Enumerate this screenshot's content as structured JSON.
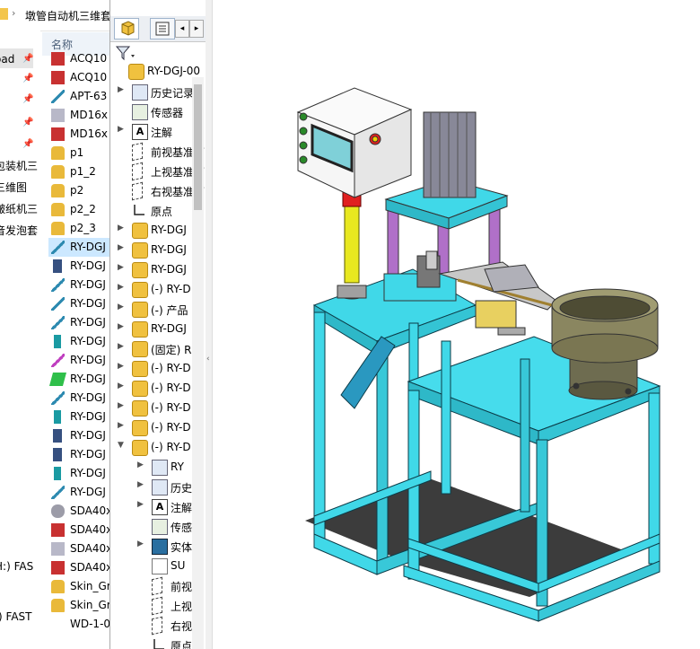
{
  "explorer": {
    "address_path": "墩管自动机三维套",
    "column_header": "名称",
    "nav_items": [
      {
        "label": "oad",
        "pinned": true
      },
      {
        "label": "",
        "pinned": true
      },
      {
        "label": "",
        "pinned": true
      },
      {
        "label": "",
        "pinned": true
      },
      {
        "label": "",
        "pinned": true
      },
      {
        "label": "包装机三",
        "pinned": false
      },
      {
        "label": "三维图",
        "pinned": false
      },
      {
        "label": "皱纸机三",
        "pinned": false
      },
      {
        "label": "音发泡套",
        "pinned": false
      },
      {
        "label": "H:) FAS",
        "pinned": false
      },
      {
        "label": ":) FAST",
        "pinned": false
      }
    ],
    "files": [
      {
        "name": "ACQ10",
        "icon": "red"
      },
      {
        "name": "ACQ10",
        "icon": "red"
      },
      {
        "name": "APT-63",
        "icon": "line"
      },
      {
        "name": "MD16x",
        "icon": "part"
      },
      {
        "name": "MD16x",
        "icon": "red"
      },
      {
        "name": "p1",
        "icon": "asm"
      },
      {
        "name": "p1_2",
        "icon": "asm"
      },
      {
        "name": "p2",
        "icon": "asm"
      },
      {
        "name": "p2_2",
        "icon": "asm"
      },
      {
        "name": "p2_3",
        "icon": "asm"
      },
      {
        "name": "RY-DGJ",
        "icon": "line",
        "selected": true
      },
      {
        "name": "RY-DGJ",
        "icon": "navy"
      },
      {
        "name": "RY-DGJ",
        "icon": "line"
      },
      {
        "name": "RY-DGJ",
        "icon": "line"
      },
      {
        "name": "RY-DGJ",
        "icon": "line"
      },
      {
        "name": "RY-DGJ",
        "icon": "teal"
      },
      {
        "name": "RY-DGJ",
        "icon": "violet"
      },
      {
        "name": "RY-DGJ",
        "icon": "green"
      },
      {
        "name": "RY-DGJ",
        "icon": "line"
      },
      {
        "name": "RY-DGJ",
        "icon": "teal"
      },
      {
        "name": "RY-DGJ",
        "icon": "navy"
      },
      {
        "name": "RY-DGJ",
        "icon": "navy"
      },
      {
        "name": "RY-DGJ",
        "icon": "teal"
      },
      {
        "name": "RY-DGJ",
        "icon": "line"
      },
      {
        "name": "SDA40x",
        "icon": "gray"
      },
      {
        "name": "SDA40x",
        "icon": "red"
      },
      {
        "name": "SDA40x",
        "icon": "part"
      },
      {
        "name": "SDA40x",
        "icon": "red"
      },
      {
        "name": "Skin_Gr",
        "icon": "asm"
      },
      {
        "name": "Skin_Gr",
        "icon": "asm"
      },
      {
        "name": "WD-1-0",
        "icon": "none"
      }
    ]
  },
  "feature_tree": {
    "top_item": "RY-DGJ-00",
    "items": [
      {
        "label": "历史记录",
        "icon": "hist",
        "expander": "▶"
      },
      {
        "label": "传感器",
        "icon": "sensor",
        "expander": ""
      },
      {
        "label": "注解",
        "icon": "note",
        "expander": "▶"
      },
      {
        "label": "前视基准面",
        "icon": "plane",
        "expander": ""
      },
      {
        "label": "上视基准面",
        "icon": "plane",
        "expander": ""
      },
      {
        "label": "右视基准面",
        "icon": "plane",
        "expander": ""
      },
      {
        "label": "原点",
        "icon": "origin",
        "expander": ""
      },
      {
        "label": "RY-DGJ",
        "icon": "asm",
        "expander": "▶"
      },
      {
        "label": "RY-DGJ",
        "icon": "asm",
        "expander": "▶"
      },
      {
        "label": "RY-DGJ",
        "icon": "asm",
        "expander": "▶"
      },
      {
        "label": "(-) RY-D",
        "icon": "asm",
        "expander": "▶"
      },
      {
        "label": "(-) 产品",
        "icon": "asm",
        "expander": "▶"
      },
      {
        "label": "RY-DGJ",
        "icon": "asm",
        "expander": "▶"
      },
      {
        "label": "(固定) R",
        "icon": "asm",
        "expander": "▶"
      },
      {
        "label": "(-) RY-D",
        "icon": "asm",
        "expander": "▶"
      },
      {
        "label": "(-) RY-D",
        "icon": "asm",
        "expander": "▶"
      },
      {
        "label": "(-) RY-D",
        "icon": "asm",
        "expander": "▶"
      },
      {
        "label": "(-) RY-D",
        "icon": "asm",
        "expander": "▶"
      },
      {
        "label": "(-) RY-D",
        "icon": "asm",
        "expander": "▼"
      }
    ],
    "sub_items": [
      {
        "label": "RY",
        "icon": "hist",
        "expander": "▶"
      },
      {
        "label": "历史",
        "icon": "hist",
        "expander": "▶"
      },
      {
        "label": "注解",
        "icon": "note",
        "expander": "▶"
      },
      {
        "label": "传感",
        "icon": "sensor",
        "expander": ""
      },
      {
        "label": "实体",
        "icon": "solid",
        "expander": "▶"
      },
      {
        "label": "SU",
        "icon": "doc",
        "expander": ""
      },
      {
        "label": "前视",
        "icon": "plane",
        "expander": ""
      },
      {
        "label": "上视",
        "icon": "plane",
        "expander": ""
      },
      {
        "label": "右视",
        "icon": "plane",
        "expander": ""
      },
      {
        "label": "原点",
        "icon": "origin",
        "expander": ""
      }
    ]
  },
  "model": {
    "description_colors": {
      "frame": "#40d8e8",
      "frame_edge": "#0c3c48",
      "purple_post": "#b070c8",
      "yellow_post": "#e8e820",
      "bowl": "#8a8660",
      "panel": "#f6f6f6",
      "screen": "#7fd0d8",
      "floor": "#3c3c3c"
    }
  }
}
